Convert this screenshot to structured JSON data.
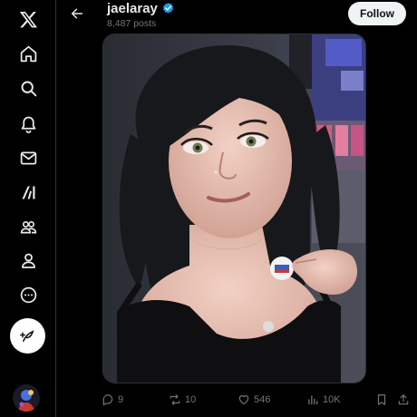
{
  "profile": {
    "display_name": "jaelaray",
    "post_count": "8,487 posts",
    "follow_label": "Follow"
  },
  "sidebar": {
    "items": [
      {
        "icon": "x-logo-icon"
      },
      {
        "icon": "home-icon"
      },
      {
        "icon": "search-icon"
      },
      {
        "icon": "notifications-icon"
      },
      {
        "icon": "messages-icon"
      },
      {
        "icon": "grok-icon"
      },
      {
        "icon": "communities-icon"
      },
      {
        "icon": "profile-icon"
      },
      {
        "icon": "more-icon"
      }
    ],
    "post_button_icon": "compose-icon"
  },
  "actions": {
    "replies": "9",
    "reposts": "10",
    "likes": "546",
    "views": "10K"
  },
  "colors": {
    "background": "#000000",
    "muted": "#71767b",
    "verified": "#1d9bf0",
    "follow_bg": "#eff3f4"
  }
}
